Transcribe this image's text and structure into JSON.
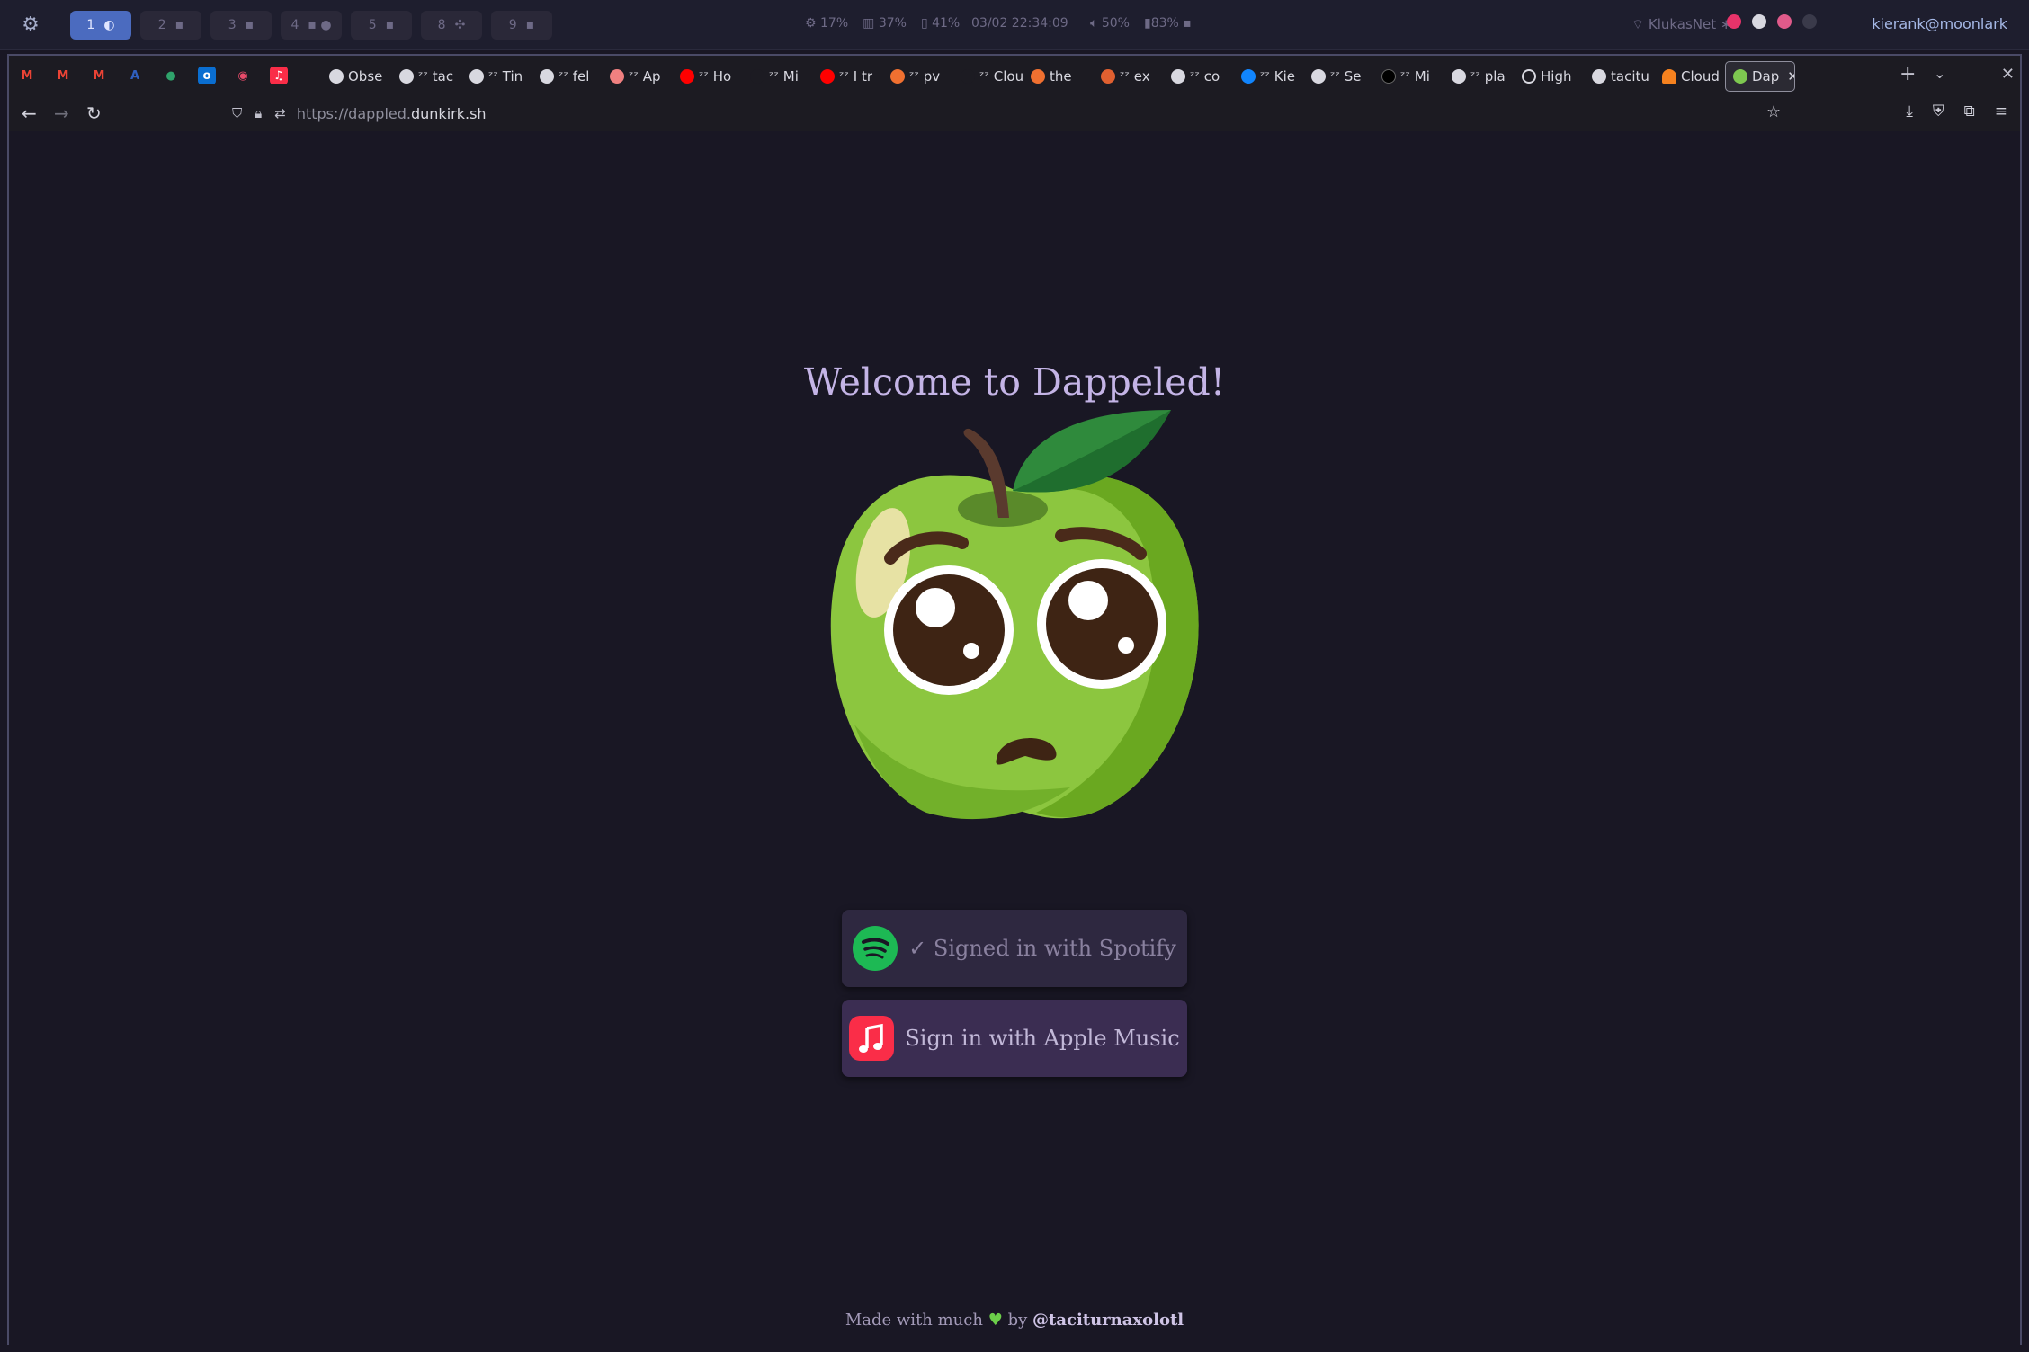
{
  "sysbar": {
    "workspaces": [
      {
        "num": "1",
        "active": true
      },
      {
        "num": "2"
      },
      {
        "num": "3"
      },
      {
        "num": "4"
      },
      {
        "num": "5"
      },
      {
        "num": "8"
      },
      {
        "num": "9"
      }
    ],
    "cpu": "17%",
    "mem": "37%",
    "disk": "41%",
    "clock": "03/02 22:34:09",
    "volume": "50%",
    "battery": "83%",
    "network": "KlukasNet",
    "user": "kierank@moonlark"
  },
  "browser": {
    "tabs": [
      {
        "label": "Obse",
        "icon": "obsidian-icon"
      },
      {
        "label": "ᶻᶻ tac",
        "icon": "github-icon"
      },
      {
        "label": "ᶻᶻ Tin",
        "icon": "wand-icon"
      },
      {
        "label": "ᶻᶻ fel",
        "icon": "github-icon"
      },
      {
        "label": "ᶻᶻ Ap",
        "icon": "app-icon"
      },
      {
        "label": "ᶻᶻ Ho",
        "icon": "youtube-icon"
      },
      {
        "label": "ᶻᶻ Mi",
        "icon": "blank-icon"
      },
      {
        "label": "ᶻᶻ I tr",
        "icon": "youtube-icon"
      },
      {
        "label": "ᶻᶻ pv",
        "icon": "x-icon"
      },
      {
        "label": "ᶻᶻ Cloud",
        "icon": "blank-icon"
      },
      {
        "label": "the",
        "icon": "x-icon"
      },
      {
        "label": "ᶻᶻ ex",
        "icon": "orange-icon"
      },
      {
        "label": "ᶻᶻ co",
        "icon": "github-icon"
      },
      {
        "label": "ᶻᶻ Kie",
        "icon": "bluesky-icon"
      },
      {
        "label": "ᶻᶻ Se",
        "icon": "openai-icon"
      },
      {
        "label": "ᶻᶻ Mi",
        "icon": "dev-icon"
      },
      {
        "label": "ᶻᶻ pla",
        "icon": "github-icon"
      },
      {
        "label": "High",
        "icon": "globe-icon"
      },
      {
        "label": "tacitu",
        "icon": "github-icon"
      },
      {
        "label": "Cloud",
        "icon": "cloud-icon"
      },
      {
        "label": "Dap",
        "icon": "apple-icon",
        "active": true
      }
    ],
    "url_prefix": "https://dappled.",
    "url_domain": "dunkirk.sh"
  },
  "page": {
    "welcome": "Welcome to Dappeled!",
    "spotify_label": "✓ Signed in with Spotify",
    "apple_label": "Sign in with Apple Music",
    "footer_pre": "Made with much",
    "footer_by": "by",
    "footer_handle": "@taciturnaxolotl"
  },
  "colors": {
    "bg": "#191724",
    "accent": "#c4b4e6",
    "spotify": "#1db954",
    "apple_music": "#fa2d48"
  }
}
